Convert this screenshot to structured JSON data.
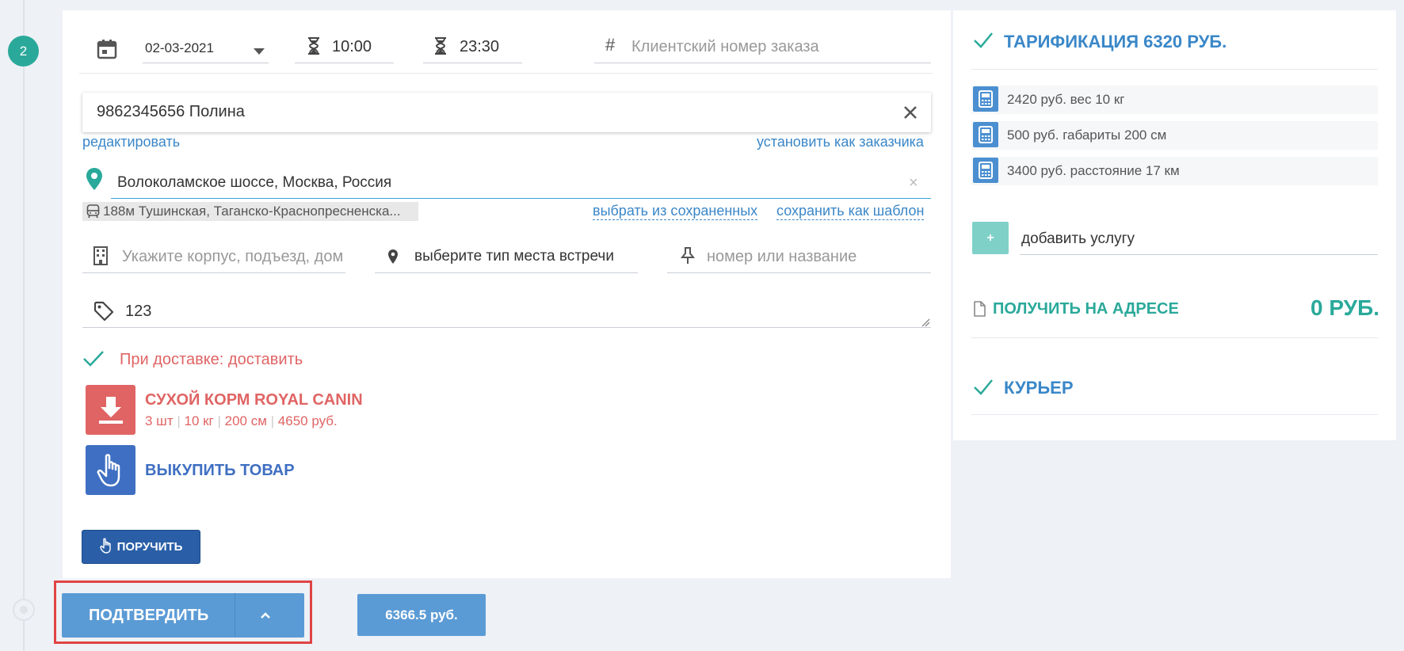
{
  "timeline": {
    "step_number": "2"
  },
  "schedule": {
    "date": "02-03-2021",
    "time_from": "10:00",
    "time_to": "23:30",
    "order_number_placeholder": "Клиентский номер заказа"
  },
  "client": {
    "value": "9862345656 Полина",
    "edit_link": "редактировать",
    "set_customer_link": "установить как заказчика"
  },
  "address": {
    "value": "Волоколамское шоссе, Москва, Россия",
    "metro": "188м Тушинская, Таганско-Краснопресненска...",
    "choose_saved_link": "выбрать из сохраненных",
    "save_template_link": "сохранить как шаблон"
  },
  "location": {
    "building_placeholder": "Укажите корпус, подъезд, дом",
    "meeting_type": "выберите тип места встречи",
    "number_placeholder": "номер или название"
  },
  "comment": {
    "value": "123"
  },
  "delivery": {
    "action_label": "При доставке: доставить",
    "item_title": "СУХОЙ КОРМ ROYAL CANIN",
    "item_qty": "3 шт",
    "item_weight": "10 кг",
    "item_size": "200 см",
    "item_price": "4650 руб.",
    "buy_label": "ВЫКУПИТЬ ТОВАР",
    "assign_button": "ПОРУЧИТЬ"
  },
  "footer": {
    "confirm_button": "ПОДТВЕРДИТЬ",
    "total_price": "6366.5 руб."
  },
  "tariff": {
    "title": "ТАРИФИКАЦИЯ 6320 РУБ.",
    "rows": [
      "2420 руб. вес 10 кг",
      "500 руб. габариты 200 см",
      "3400 руб. расстояние 17 км"
    ],
    "add_service_plus": "+",
    "add_service": "добавить услугу",
    "collect_label": "ПОЛУЧИТЬ НА АДРЕСЕ",
    "collect_amount": "0 РУБ.",
    "courier_label": "КУРЬЕР"
  },
  "colors": {
    "accent_blue": "#3a87c8",
    "accent_teal": "#2aa99a",
    "danger_red": "#e06464",
    "button_blue": "#5b9bd5",
    "dark_blue": "#2a5fa8"
  }
}
